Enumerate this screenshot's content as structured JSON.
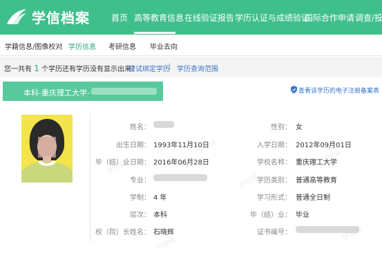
{
  "header": {
    "brand": "学信档案",
    "nav": [
      "首页",
      "高等教育信息",
      "在线验证报告",
      "学历认证与成绩验证",
      "国际合作申请",
      "调查/投票"
    ]
  },
  "subnav": {
    "items": [
      "学籍信息/图像校对",
      "学历信息",
      "考研信息",
      "毕业去向"
    ]
  },
  "info": {
    "prefix": "您一共有",
    "count": "1",
    "suffix": "个学历",
    "question": "还有学历没有显示出来？",
    "bind_link": "尝试绑定学历",
    "sep": "|",
    "scope_link": "学历查询范围"
  },
  "card": {
    "banner_text": "本科-重庆理工大学-",
    "record_link": "查看该学历的电子注册备案表"
  },
  "fields_left": [
    {
      "label": "姓名：",
      "value": ""
    },
    {
      "label": "出生日期：",
      "value": "1993年11月10日"
    },
    {
      "label": "毕（结）业日期：",
      "value": "2016年06月28日"
    },
    {
      "label": "专业：",
      "value": ""
    },
    {
      "label": "学制：",
      "value": "4 年"
    },
    {
      "label": "层次：",
      "value": "本科"
    },
    {
      "label": "校（院）长姓名：",
      "value": "石晓辉"
    }
  ],
  "fields_right": [
    {
      "label": "性别：",
      "value": "女"
    },
    {
      "label": "入学日期：",
      "value": "2012年09月01日"
    },
    {
      "label": "学校名称：",
      "value": "重庆理工大学"
    },
    {
      "label": "学历类别：",
      "value": "普通高等教育"
    },
    {
      "label": "学习形式：",
      "value": "普通全日制"
    },
    {
      "label": "毕（结）业：",
      "value": "毕业"
    },
    {
      "label": "证书编号：",
      "value": ""
    }
  ],
  "watermark": "学信网",
  "colors": {
    "brand_green": "#3fbf8c",
    "banner_green": "#57c99d",
    "link_blue": "#3a74c9",
    "photo_bg": "#f2e44a"
  }
}
